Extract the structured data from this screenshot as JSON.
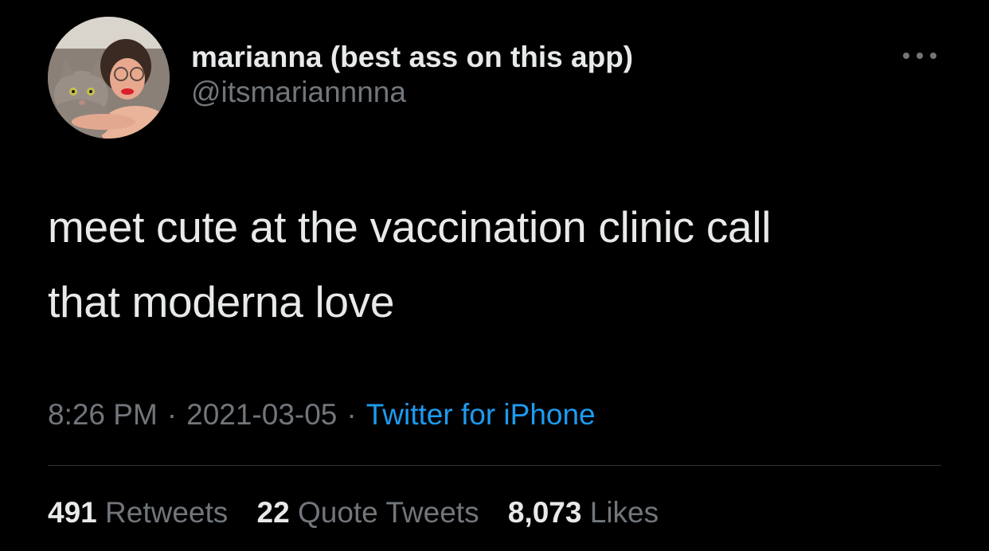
{
  "tweet": {
    "author": {
      "display_name": "marianna (best ass on this app)",
      "handle": "@itsmariannnna"
    },
    "text_lines": [
      "meet cute at the vaccination clinic call",
      "that moderna love"
    ],
    "time": "8:26 PM",
    "separator": "·",
    "date": "2021-03-05",
    "source": "Twitter for iPhone",
    "stats": {
      "retweets_count": "491",
      "retweets_label": "Retweets",
      "quotes_count": "22",
      "quotes_label": "Quote Tweets",
      "likes_count": "8,073",
      "likes_label": "Likes"
    }
  },
  "icons": {
    "more": "more-horizontal-icon",
    "avatar": "profile-photo"
  },
  "colors": {
    "background": "#000000",
    "primary_text": "#e7e9ea",
    "secondary_text": "#71767b",
    "link": "#1d9bf0",
    "divider": "#2f3336"
  }
}
